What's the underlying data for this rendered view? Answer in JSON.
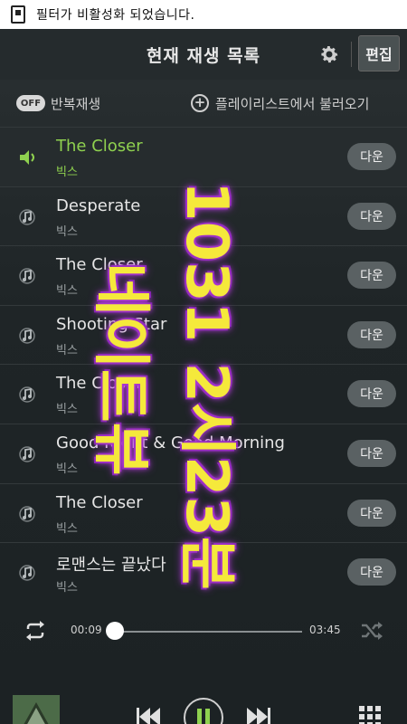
{
  "status": {
    "text": "필터가 비활성화 되었습니다."
  },
  "header": {
    "title": "현재 재생 목록",
    "edit_label": "편집"
  },
  "toolbar": {
    "off_label": "OFF",
    "repeat_label": "반복재생",
    "load_label": "플레이리스트에서 불러오기"
  },
  "playlist": [
    {
      "title": "The Closer",
      "artist": "빅스",
      "down": "다운",
      "active": true
    },
    {
      "title": "Desperate",
      "artist": "빅스",
      "down": "다운"
    },
    {
      "title": "The Closer",
      "artist": "빅스",
      "down": "다운"
    },
    {
      "title": "Shooting Star",
      "artist": "빅스",
      "down": "다운"
    },
    {
      "title": "The Closer",
      "artist": "빅스",
      "down": "다운"
    },
    {
      "title": "Good Night & Good Morning",
      "artist": "빅스",
      "down": "다운"
    },
    {
      "title": "The Closer",
      "artist": "빅스",
      "down": "다운"
    },
    {
      "title": "로맨스는 끝났다",
      "artist": "빅스",
      "down": "다운"
    }
  ],
  "overlay": {
    "line1": "1031 2시23분",
    "line2": "네이트뷰"
  },
  "player": {
    "current_time": "00:09",
    "total_time": "03:45",
    "progress": 0.04
  },
  "icons": {
    "active_row": "speaker-icon",
    "row": "note-icon",
    "settings": "gear-icon",
    "repeat": "repeat-icon",
    "shuffle": "shuffle-icon"
  },
  "colors": {
    "accent": "#8fd14f",
    "overlay": "#f5e93b",
    "overlay_glow": "#b23bd8"
  }
}
